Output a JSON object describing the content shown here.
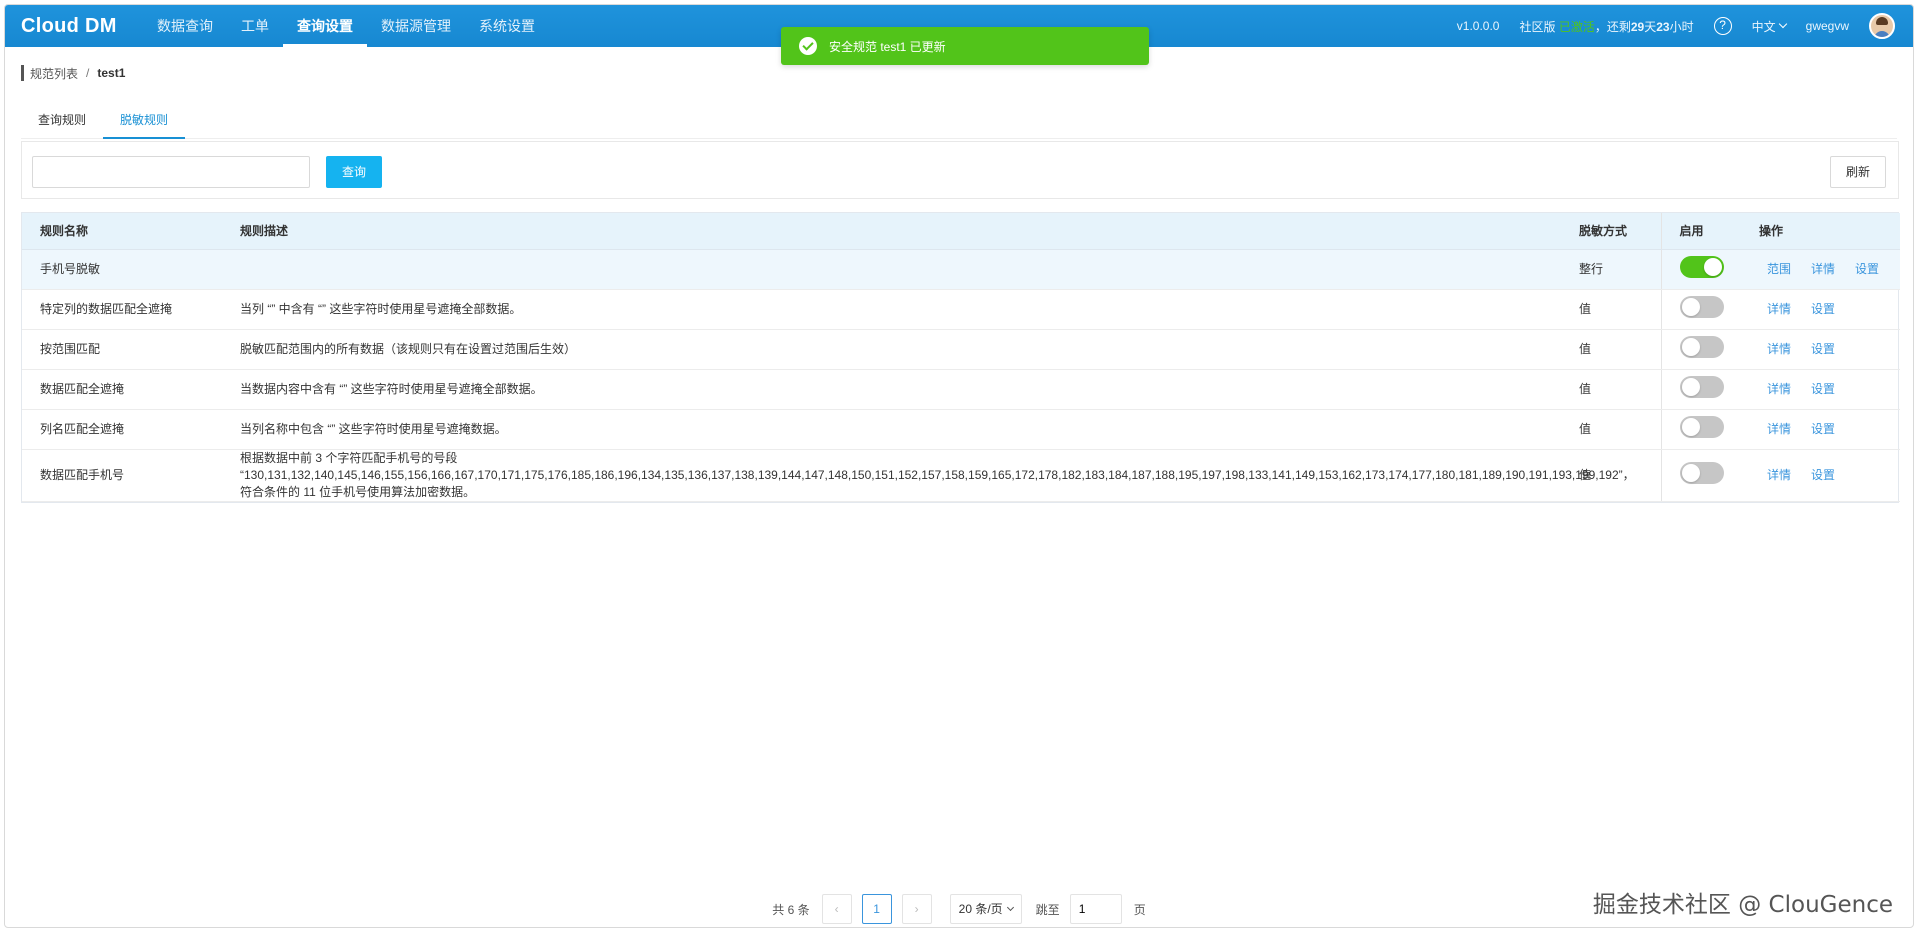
{
  "nav": {
    "logo": "Cloud DM",
    "items": [
      "数据查询",
      "工单",
      "查询设置",
      "数据源管理",
      "系统设置"
    ],
    "version": "v1.0.0.0",
    "edition": "社区版",
    "activation": "已激活",
    "remaining_prefix": "，还剩",
    "remaining_days": "29",
    "remaining_days_unit": "天",
    "remaining_hours": "23",
    "remaining_hours_unit": "小时",
    "help": "?",
    "language": "中文",
    "username": "gwegvw"
  },
  "toast": {
    "message": "安全规范 test1 已更新"
  },
  "breadcrumb": {
    "parent": "规范列表",
    "separator": "/",
    "current": "test1"
  },
  "tabs": [
    "查询规则",
    "脱敏规则"
  ],
  "toolbar": {
    "search_value": "",
    "query_label": "查询",
    "refresh_label": "刷新"
  },
  "table": {
    "headers": [
      "规则名称",
      "规则描述",
      "脱敏方式",
      "启用",
      "操作"
    ],
    "rows": [
      {
        "name": "手机号脱敏",
        "desc": "",
        "method": "整行",
        "enabled": true,
        "ops": [
          "范围",
          "详情",
          "设置"
        ]
      },
      {
        "name": "特定列的数据匹配全遮掩",
        "desc": "当列 “” 中含有 “” 这些字符时使用星号遮掩全部数据。",
        "method": "值",
        "enabled": false,
        "ops": [
          "详情",
          "设置"
        ]
      },
      {
        "name": "按范围匹配",
        "desc": "脱敏匹配范围内的所有数据（该规则只有在设置过范围后生效）",
        "method": "值",
        "enabled": false,
        "ops": [
          "详情",
          "设置"
        ]
      },
      {
        "name": "数据匹配全遮掩",
        "desc": "当数据内容中含有 “” 这些字符时使用星号遮掩全部数据。",
        "method": "值",
        "enabled": false,
        "ops": [
          "详情",
          "设置"
        ]
      },
      {
        "name": "列名匹配全遮掩",
        "desc": "当列名称中包含 “” 这些字符时使用星号遮掩数据。",
        "method": "值",
        "enabled": false,
        "ops": [
          "详情",
          "设置"
        ]
      },
      {
        "name": "数据匹配手机号",
        "desc": "根据数据中前 3 个字符匹配手机号的号段 “130,131,132,140,145,146,155,156,166,167,170,171,175,176,185,186,196,134,135,136,137,138,139,144,147,148,150,151,152,157,158,159,165,172,178,182,183,184,187,188,195,197,198,133,141,149,153,162,173,174,177,180,181,189,190,191,193,199,192”，符合条件的 11 位手机号使用算法加密数据。",
        "method": "值",
        "enabled": false,
        "ops": [
          "详情",
          "设置"
        ]
      }
    ]
  },
  "pagination": {
    "total": "共 6 条",
    "prev": "‹",
    "current_page": "1",
    "next": "›",
    "page_size": "20 条/页",
    "jump_label": "跳至",
    "jump_value": "1",
    "page_unit": "页"
  },
  "watermark": "掘金技术社区 @ ClouGence"
}
